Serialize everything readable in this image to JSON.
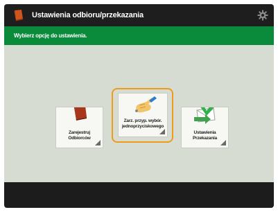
{
  "titlebar": {
    "title": "Ustawienia odbioru/przekazania",
    "icon": "inbox-book-icon",
    "settings_icon": "gear-icon"
  },
  "instruction": {
    "text": "Wybierz opcję do ustawienia."
  },
  "tiles": [
    {
      "label_line1": "Zarejestruj",
      "label_line2": "Odbiorców",
      "icon": "address-book-icon",
      "selected": false
    },
    {
      "label_line1": "Zarz. przyp. wybór.",
      "label_line2": "jednoprzyciskowego",
      "icon": "hand-pointing-icon",
      "selected": true
    },
    {
      "label_line1": "Ustawienia",
      "label_line2": "Przekazania",
      "icon": "forwarding-envelope-icon",
      "selected": false
    }
  ],
  "colors": {
    "titlebar": "#1e1e1e",
    "instruction_bar": "#0a8b3b",
    "content_bg": "#d7dcd2",
    "selection_highlight": "#f09a1a"
  }
}
